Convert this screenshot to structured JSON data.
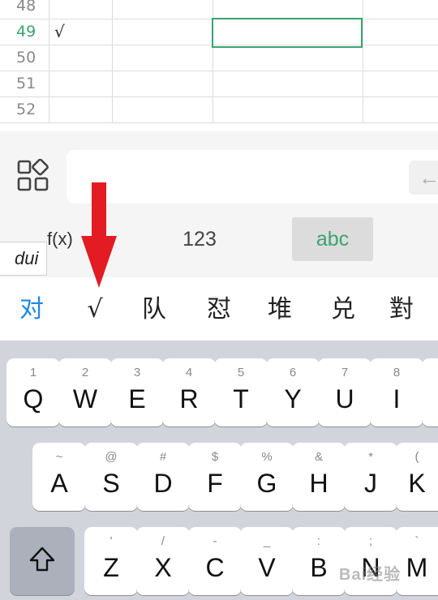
{
  "sheet": {
    "rows": [
      {
        "num": "48",
        "mark": ""
      },
      {
        "num": "49",
        "mark": "√"
      },
      {
        "num": "50",
        "mark": ""
      },
      {
        "num": "51",
        "mark": ""
      },
      {
        "num": "52",
        "mark": ""
      }
    ]
  },
  "formula": {
    "back_icon": "←",
    "modes": {
      "fx": "f(x)",
      "num": "123",
      "abc": "abc"
    },
    "pinyin": "dui"
  },
  "candidates": [
    "对",
    "√",
    "队",
    "怼",
    "堆",
    "兑",
    "對"
  ],
  "keyboard": {
    "row1": [
      {
        "sub": "1",
        "key": "Q"
      },
      {
        "sub": "2",
        "key": "W"
      },
      {
        "sub": "3",
        "key": "E"
      },
      {
        "sub": "4",
        "key": "R"
      },
      {
        "sub": "5",
        "key": "T"
      },
      {
        "sub": "6",
        "key": "Y"
      },
      {
        "sub": "7",
        "key": "U"
      },
      {
        "sub": "8",
        "key": "I"
      }
    ],
    "row2": [
      {
        "sub": "~",
        "key": "A"
      },
      {
        "sub": "@",
        "key": "S"
      },
      {
        "sub": "#",
        "key": "D"
      },
      {
        "sub": "$",
        "key": "F"
      },
      {
        "sub": "%",
        "key": "G"
      },
      {
        "sub": "&",
        "key": "H"
      },
      {
        "sub": "*",
        "key": "J"
      },
      {
        "sub": "(",
        "key": "K"
      }
    ],
    "row3": [
      {
        "sub": "'",
        "key": "Z"
      },
      {
        "sub": "/",
        "key": "X"
      },
      {
        "sub": "-",
        "key": "C"
      },
      {
        "sub": "_",
        "key": "V"
      },
      {
        "sub": ":",
        "key": "B"
      },
      {
        "sub": ";",
        "key": "N"
      },
      {
        "sub": "`",
        "key": "M"
      }
    ]
  },
  "watermark": "Bai经验",
  "colors": {
    "accent": "#3aa36f",
    "candidate_highlight": "#1e88e5",
    "arrow": "#e31b23"
  }
}
